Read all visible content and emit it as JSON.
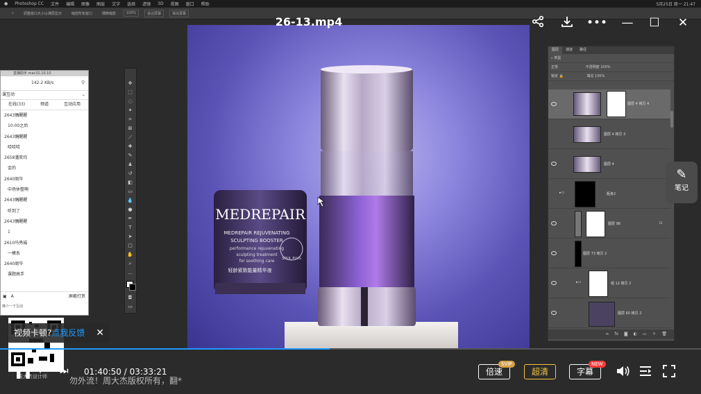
{
  "app": {
    "menu_items": [
      "Photoshop CC",
      "文件",
      "编辑",
      "图像",
      "图层",
      "文字",
      "选择",
      "滤镜",
      "3D",
      "视图",
      "窗口",
      "帮助"
    ],
    "clock": "5月25日 周一  21:47",
    "options_bar": [
      "调整窗口大小以满屏显示",
      "缩放所有窗口",
      "细微缩放",
      "100%",
      "适合屏幕",
      "填充屏幕"
    ]
  },
  "video": {
    "title": "26-13.mp4",
    "current_time": "01:40:50",
    "separator": "/",
    "total_time": "03:33:21",
    "progress_fraction": 0.47,
    "feedback_text": "视频卡顿?",
    "feedback_link": "点我反馈",
    "speed_label": "倍速",
    "speed_badge": "SVIP",
    "quality_label": "超清",
    "subtitle_label": "字幕",
    "subtitle_badge": "NEW",
    "notes_label": "笔记",
    "subtitle_text": "勿外流！周大杰版权所有，翻*"
  },
  "product": {
    "jar_brand": "MEDREPAIR",
    "jar_line1": "MEDREPAIR REJUVENATING",
    "jar_line2": "SCULPTING BOOSTER",
    "jar_line3": "performance rejuvenating",
    "jar_line4": "sculpting treatment",
    "jar_line5": "for soothing care",
    "jar_cn": "轻龄紧致能量精华液",
    "jar_seal": "SOUL PLUS"
  },
  "chat": {
    "header": "直播助手 mac32.10.10",
    "speed": "142.2 KB/s",
    "section": "课互动",
    "tabs": [
      "在线(33)",
      "频道",
      "互动应用"
    ],
    "messages": [
      {
        "user": "2643偶醒醒",
        "text": "10:00之后"
      },
      {
        "user": "2643偶醒醒",
        "text": "哈哈哈"
      },
      {
        "user": "2658潘奕均",
        "text": "金的"
      },
      {
        "user": "2640周华",
        "text": "中场休整啊"
      },
      {
        "user": "2643偶醒醒",
        "text": "听到了"
      },
      {
        "user": "2643偶醒醒",
        "text": "1"
      },
      {
        "user": "2610马秀娟",
        "text": "一模系"
      },
      {
        "user": "2640周华",
        "text": "课题高手"
      }
    ],
    "checkbox_label": "屏蔽打赏",
    "footer": "推介一下互动",
    "qr_caption": "周大杰设计师"
  },
  "layers": {
    "tabs": [
      "图层",
      "通道",
      "路径"
    ],
    "kind": "类型",
    "blend": "正常",
    "opacity_label": "不透明度",
    "opacity": "100%",
    "lock_label": "锁定",
    "fill_label": "填充",
    "fill": "100%",
    "items": [
      {
        "name": "图层 4 拷贝 4"
      },
      {
        "name": "图层 4 拷贝 3"
      },
      {
        "name": "图层 4"
      },
      {
        "name": "瓶身2"
      },
      {
        "name": "图层 98"
      },
      {
        "name": "图层 73 拷贝 2"
      },
      {
        "name": "组 12 拷贝 2"
      },
      {
        "name": "图层 60 拷贝 2"
      }
    ]
  },
  "colors": {
    "accent": "#1e9bff",
    "quality": "#f5c542",
    "badge_svip": "#d4a24a",
    "badge_new": "#ff3b3b"
  }
}
